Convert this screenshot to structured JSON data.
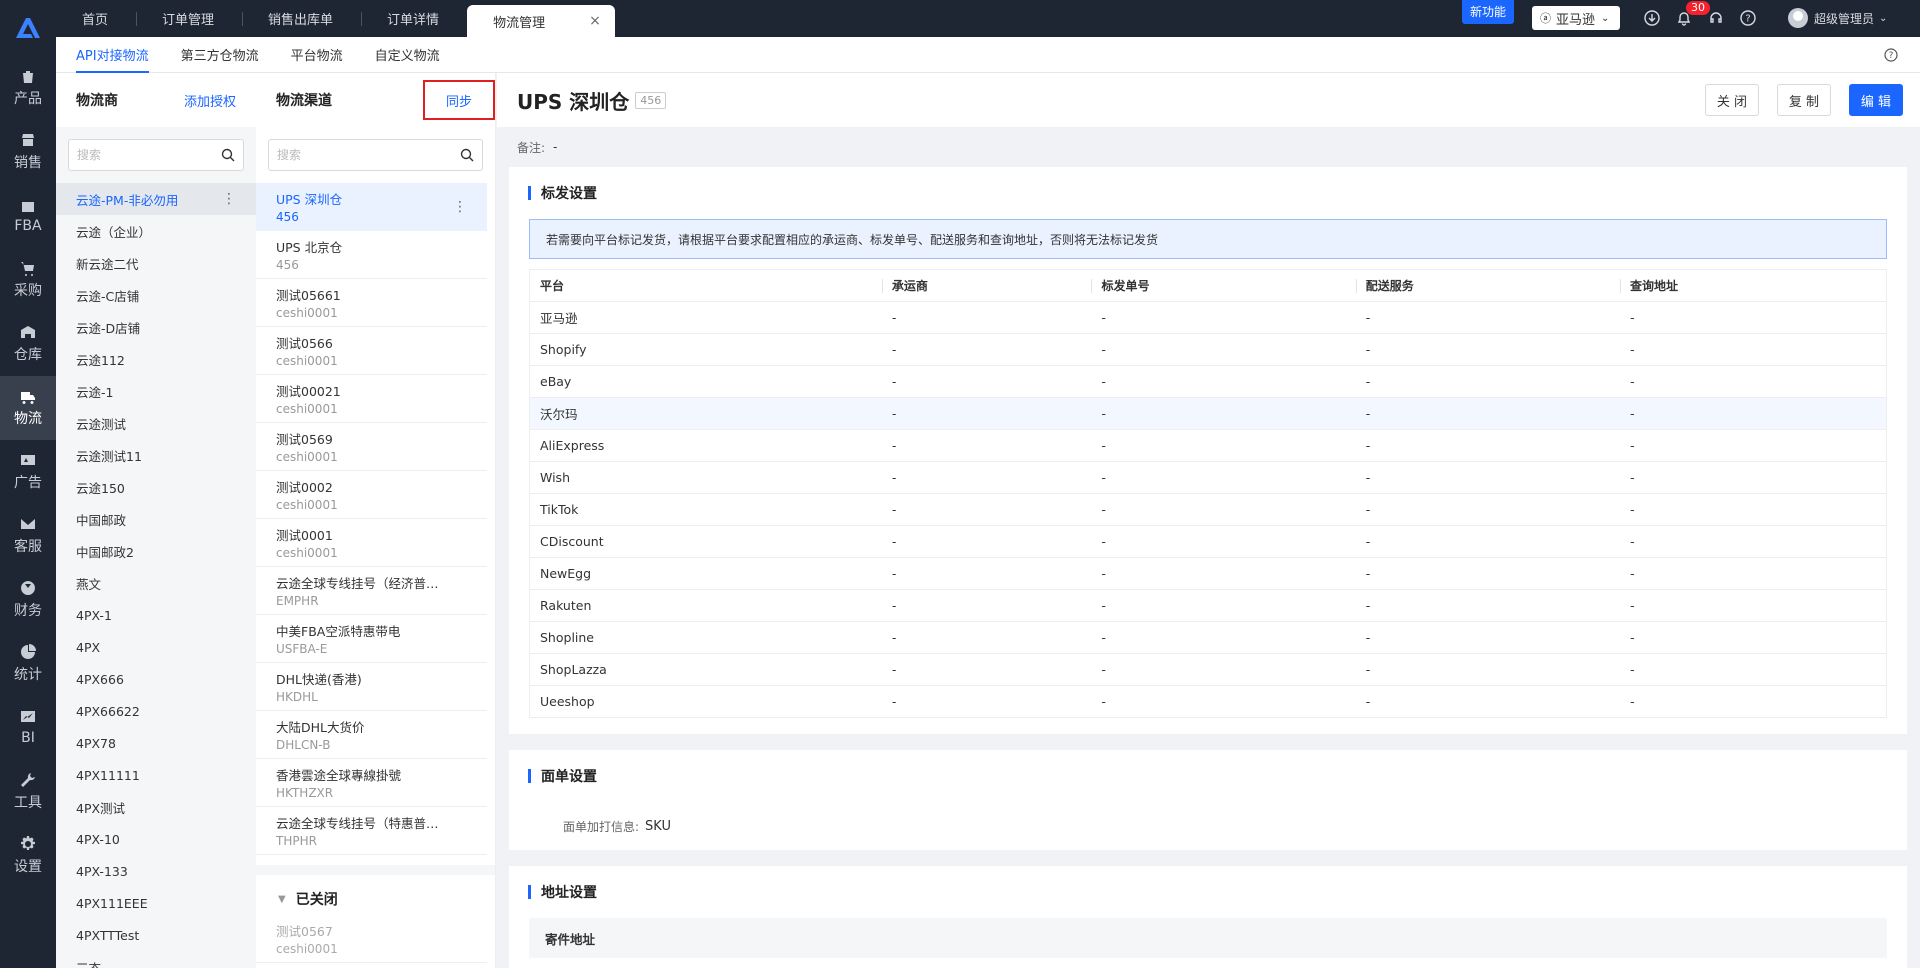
{
  "rail": {
    "items": [
      {
        "label": "产品",
        "icon": "bag-icon"
      },
      {
        "label": "销售",
        "icon": "store-icon"
      },
      {
        "label": "FBA",
        "icon": "box-icon"
      },
      {
        "label": "采购",
        "icon": "cart-icon"
      },
      {
        "label": "仓库",
        "icon": "warehouse-icon"
      },
      {
        "label": "物流",
        "icon": "truck-icon",
        "active": true
      },
      {
        "label": "广告",
        "icon": "ad-icon"
      },
      {
        "label": "客服",
        "icon": "mail-icon"
      },
      {
        "label": "财务",
        "icon": "yen-icon"
      },
      {
        "label": "统计",
        "icon": "pie-icon"
      },
      {
        "label": "BI",
        "icon": "chart-icon"
      },
      {
        "label": "工具",
        "icon": "wrench-icon"
      },
      {
        "label": "设置",
        "icon": "gear-icon"
      }
    ]
  },
  "topbar": {
    "tabs": [
      "首页",
      "订单管理",
      "销售出库单",
      "订单详情",
      "物流管理"
    ],
    "active_tab": "物流管理",
    "new_feature": "新功能",
    "shop": "亚马逊",
    "notification_count": "30",
    "user": "超级管理员"
  },
  "subtabs": [
    "API对接物流",
    "第三方仓物流",
    "平台物流",
    "自定义物流"
  ],
  "carriers": {
    "title": "物流商",
    "add_auth": "添加授权",
    "search_placeholder": "搜索",
    "items": [
      "云途-PM-非必勿用",
      "云途（企业）",
      "新云途二代",
      "云途-C店铺",
      "云途-D店铺",
      "云途112",
      "云途-1",
      "云途测试",
      "云途测试11",
      "云途150",
      "中国邮政",
      "中国邮政2",
      "燕文",
      "4PX-1",
      "4PX",
      "4PX666",
      "4PX66622",
      "4PX78",
      "4PX11111",
      "4PX测试",
      "4PX-10",
      "4PX-133",
      "4PX111EEE",
      "4PXTTTest",
      "三态"
    ]
  },
  "channels": {
    "title": "物流渠道",
    "sync": "同步",
    "search_placeholder": "搜索",
    "items": [
      {
        "name": "UPS 深圳仓",
        "code": "456"
      },
      {
        "name": "UPS 北京仓",
        "code": "456"
      },
      {
        "name": "测试05661",
        "code": "ceshi0001"
      },
      {
        "name": "测试0566",
        "code": "ceshi0001"
      },
      {
        "name": "测试00021",
        "code": "ceshi0001"
      },
      {
        "name": "测试0569",
        "code": "ceshi0001"
      },
      {
        "name": "测试0002",
        "code": "ceshi0001"
      },
      {
        "name": "测试0001",
        "code": "ceshi0001"
      },
      {
        "name": "云途全球专线挂号（经济普货）",
        "code": "EMPHR"
      },
      {
        "name": "中美FBA空派特惠带电",
        "code": "USFBA-E"
      },
      {
        "name": "DHL快递(香港)",
        "code": "HKDHL"
      },
      {
        "name": "大陆DHL大货价",
        "code": "DHLCN-B"
      },
      {
        "name": "香港雲途全球專線掛號",
        "code": "HKTHZXR"
      },
      {
        "name": "云途全球专线挂号（特惠普货...",
        "code": "THPHR"
      }
    ],
    "closed_label": "已关闭",
    "closed_items": [
      {
        "name": "测试0567",
        "code": "ceshi0001"
      }
    ]
  },
  "detail": {
    "title": "UPS 深圳仓",
    "code": "456",
    "close_btn": "关 闭",
    "copy_btn": "复 制",
    "edit_btn": "编 辑",
    "remark_label": "备注:",
    "remark_value": "-",
    "mark_section": {
      "title": "标发设置",
      "alert": "若需要向平台标记发货，请根据平台要求配置相应的承运商、标发单号、配送服务和查询地址，否则将无法标记发货",
      "columns": [
        "平台",
        "承运商",
        "标发单号",
        "配送服务",
        "查询地址"
      ],
      "rows": [
        [
          "亚马逊",
          "-",
          "-",
          "-",
          "-"
        ],
        [
          "Shopify",
          "-",
          "-",
          "-",
          "-"
        ],
        [
          "eBay",
          "-",
          "-",
          "-",
          "-"
        ],
        [
          "沃尔玛",
          "-",
          "-",
          "-",
          "-"
        ],
        [
          "AliExpress",
          "-",
          "-",
          "-",
          "-"
        ],
        [
          "Wish",
          "-",
          "-",
          "-",
          "-"
        ],
        [
          "TikTok",
          "-",
          "-",
          "-",
          "-"
        ],
        [
          "CDiscount",
          "-",
          "-",
          "-",
          "-"
        ],
        [
          "NewEgg",
          "-",
          "-",
          "-",
          "-"
        ],
        [
          "Rakuten",
          "-",
          "-",
          "-",
          "-"
        ],
        [
          "Shopline",
          "-",
          "-",
          "-",
          "-"
        ],
        [
          "ShopLazza",
          "-",
          "-",
          "-",
          "-"
        ],
        [
          "Ueeshop",
          "-",
          "-",
          "-",
          "-"
        ]
      ]
    },
    "face_section": {
      "title": "面单设置",
      "label": "面单加打信息:",
      "value": "SKU"
    },
    "address_section": {
      "title": "地址设置",
      "sender": "寄件地址"
    }
  }
}
